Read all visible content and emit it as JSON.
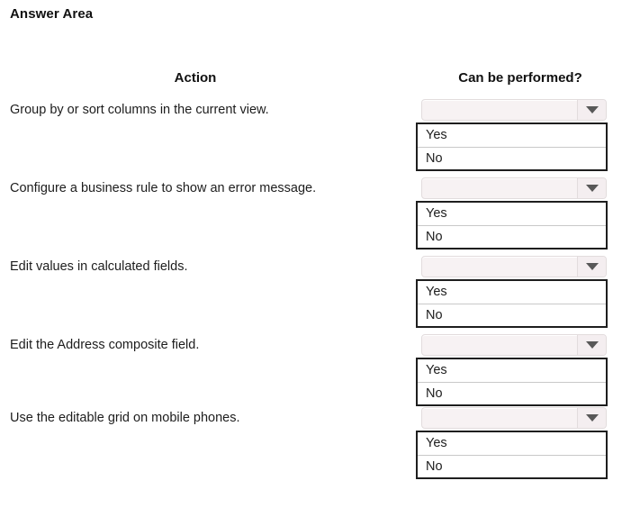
{
  "title": "Answer Area",
  "headers": {
    "action": "Action",
    "can_be_performed": "Can be performed?"
  },
  "dropdown": {
    "selected_value": "",
    "arrow_icon": "chevron-down-icon",
    "options": [
      "Yes",
      "No"
    ]
  },
  "rows": [
    {
      "action": "Group by or sort columns in the current view.",
      "selected": "",
      "options": [
        "Yes",
        "No"
      ]
    },
    {
      "action": "Configure a business rule to show an error message.",
      "selected": "",
      "options": [
        "Yes",
        "No"
      ]
    },
    {
      "action": "Edit values in calculated fields.",
      "selected": "",
      "options": [
        "Yes",
        "No"
      ]
    },
    {
      "action": "Edit the Address composite field.",
      "selected": "",
      "options": [
        "Yes",
        "No"
      ]
    },
    {
      "action": "Use the editable grid on mobile phones.",
      "selected": "",
      "options": [
        "Yes",
        "No"
      ]
    }
  ],
  "colors": {
    "page_background": "#ffffff",
    "text": "#1d1d1d",
    "combo_fill": "#f7f2f3",
    "combo_border": "#e2dcdd",
    "listbox_border": "#1e1e1e",
    "list_divider": "#c9c9c9",
    "arrow_fill": "#585858"
  }
}
